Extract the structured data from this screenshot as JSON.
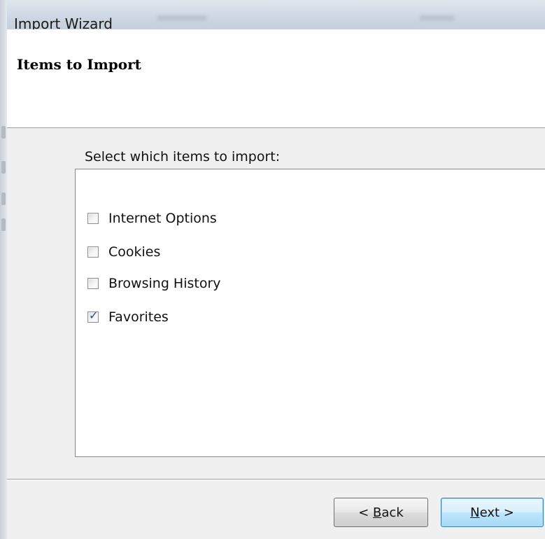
{
  "window": {
    "title": "Import Wizard"
  },
  "header": {
    "title": "Items to Import"
  },
  "body": {
    "prompt": "Select which items to import:",
    "items": [
      {
        "label": "Internet Options",
        "checked": false
      },
      {
        "label": "Cookies",
        "checked": false
      },
      {
        "label": "Browsing History",
        "checked": false
      },
      {
        "label": "Favorites",
        "checked": true
      }
    ]
  },
  "buttons": {
    "back": {
      "prefix": "< ",
      "mnemonic": "B",
      "rest": "ack"
    },
    "next": {
      "prefix": "",
      "mnemonic": "N",
      "rest": "ext >"
    }
  }
}
